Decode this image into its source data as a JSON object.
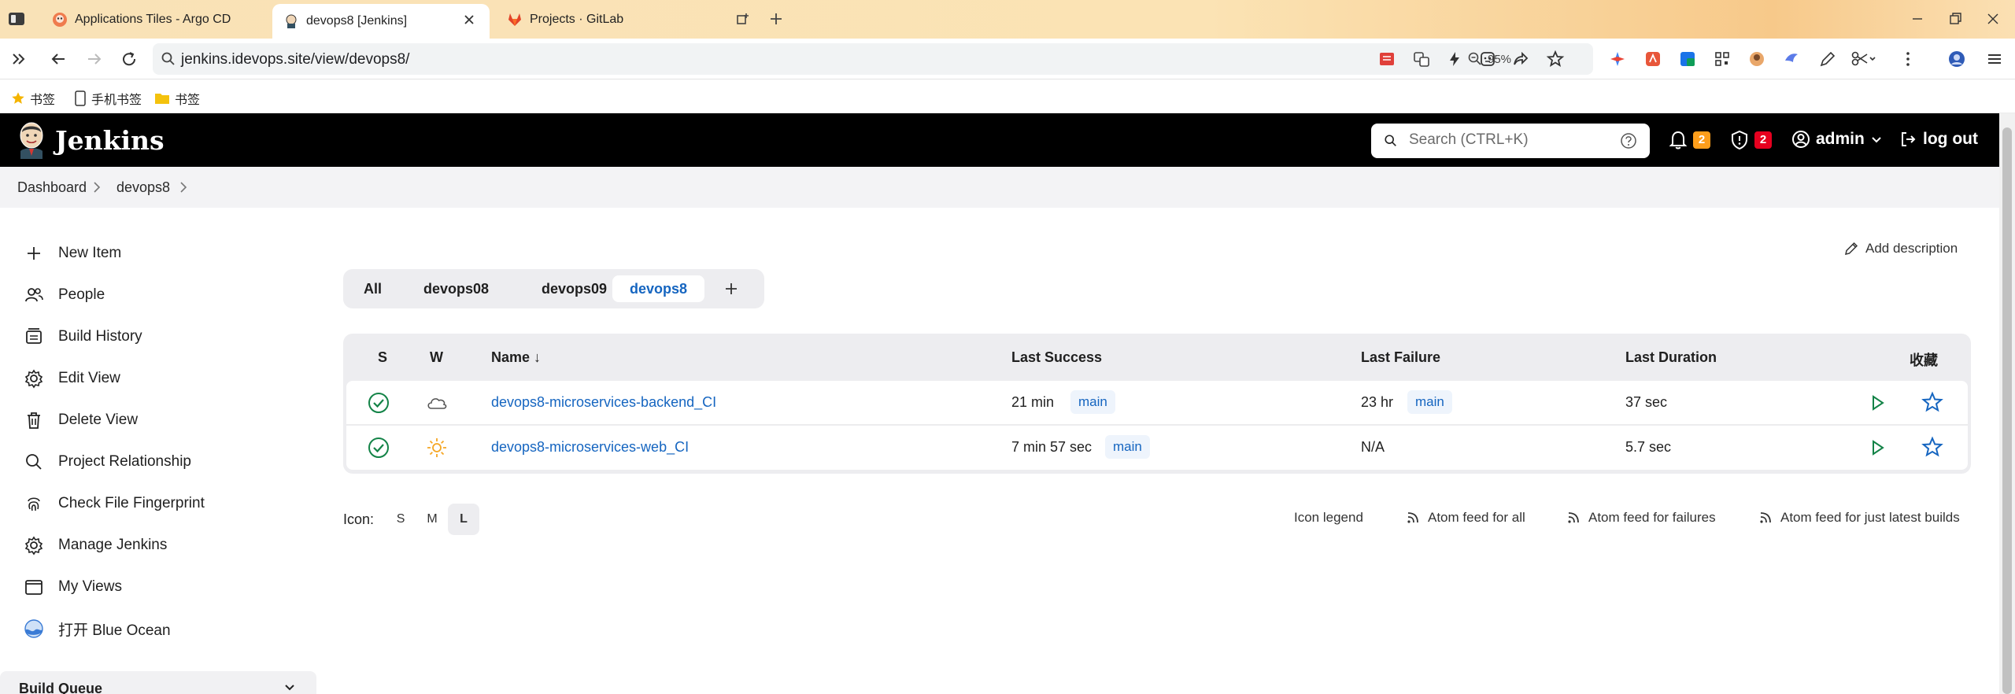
{
  "browser": {
    "tabs": [
      {
        "title": "Applications Tiles - Argo CD"
      },
      {
        "title": "devops8 [Jenkins]"
      },
      {
        "title": "Projects · GitLab"
      }
    ],
    "url": "jenkins.idevops.site/view/devops8/",
    "zoom": "95%",
    "bookmarks": [
      {
        "label": "书签"
      },
      {
        "label": "手机书签"
      },
      {
        "label": "书签"
      }
    ]
  },
  "header": {
    "app_name": "Jenkins",
    "search_placeholder": "Search (CTRL+K)",
    "notifications_count": "2",
    "security_count": "2",
    "user": "admin",
    "logout": "log out"
  },
  "breadcrumbs": [
    "Dashboard",
    "devops8"
  ],
  "sidebar": {
    "items": [
      {
        "label": "New Item",
        "icon": "plus-icon"
      },
      {
        "label": "People",
        "icon": "people-icon"
      },
      {
        "label": "Build History",
        "icon": "history-icon"
      },
      {
        "label": "Edit View",
        "icon": "gear-icon"
      },
      {
        "label": "Delete View",
        "icon": "trash-icon"
      },
      {
        "label": "Project Relationship",
        "icon": "search-icon"
      },
      {
        "label": "Check File Fingerprint",
        "icon": "fingerprint-icon"
      },
      {
        "label": "Manage Jenkins",
        "icon": "gear-icon"
      },
      {
        "label": "My Views",
        "icon": "window-icon"
      },
      {
        "label": "打开 Blue Ocean",
        "icon": "blue-ocean-icon"
      }
    ],
    "build_queue": "Build Queue"
  },
  "main": {
    "add_description": "Add description",
    "view_tabs": [
      "All",
      "devops08",
      "devops09",
      "devops8"
    ],
    "active_tab": "devops8",
    "columns": {
      "s": "S",
      "w": "W",
      "name": "Name ↓",
      "last_success": "Last Success",
      "last_failure": "Last Failure",
      "last_duration": "Last Duration",
      "favorite": "收藏"
    },
    "jobs": [
      {
        "name": "devops8-microservices-backend_CI",
        "status": "success",
        "weather": "cloudy",
        "last_success": "21 min",
        "last_success_branch": "main",
        "last_failure": "23 hr",
        "last_failure_branch": "main",
        "last_duration": "37 sec"
      },
      {
        "name": "devops8-microservices-web_CI",
        "status": "success",
        "weather": "sunny",
        "last_success": "7 min 57 sec",
        "last_success_branch": "main",
        "last_failure": "N/A",
        "last_failure_branch": "",
        "last_duration": "5.7 sec"
      }
    ],
    "icon_label": "Icon:",
    "icon_sizes": [
      "S",
      "M",
      "L"
    ],
    "icon_size_selected": "L",
    "legend": "Icon legend",
    "feeds": [
      "Atom feed for all",
      "Atom feed for failures",
      "Atom feed for just latest builds"
    ]
  },
  "colors": {
    "link": "#1565c0",
    "success": "#138347",
    "notification_badge": "#fe9e1b",
    "security_badge": "#e6001f"
  }
}
